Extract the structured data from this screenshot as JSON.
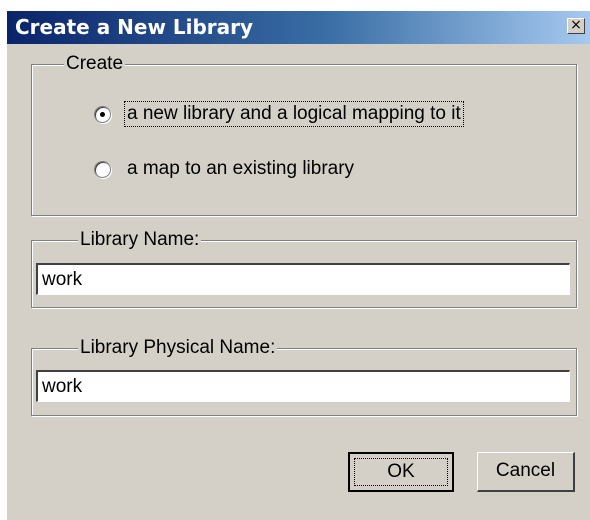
{
  "window": {
    "title": "Create a New Library",
    "close_symbol": "×",
    "close_icon": "close-icon"
  },
  "create_group": {
    "label": "Create",
    "options": [
      {
        "label": "a new library and a logical mapping to it",
        "selected": true
      },
      {
        "label": "a map to an existing library",
        "selected": false
      }
    ]
  },
  "library_name": {
    "label": "Library Name:",
    "value": "work"
  },
  "library_physical_name": {
    "label": "Library Physical Name:",
    "value": "work"
  },
  "buttons": {
    "ok": "OK",
    "cancel": "Cancel"
  }
}
